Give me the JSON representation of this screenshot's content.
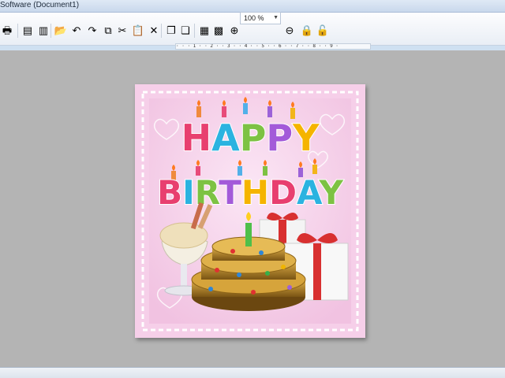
{
  "window": {
    "title": "Software  (Document1)"
  },
  "toolbar": {
    "buttons": [
      {
        "name": "print-icon",
        "glyph": "🖶"
      },
      {
        "name": "database-icon",
        "glyph": "▤"
      },
      {
        "name": "database-stack-icon",
        "glyph": "▥"
      },
      {
        "name": "open-folder-icon",
        "glyph": "📂"
      },
      {
        "name": "undo-icon",
        "glyph": "↶"
      },
      {
        "name": "redo-icon",
        "glyph": "↷"
      },
      {
        "name": "copy-icon",
        "glyph": "⧉"
      },
      {
        "name": "cut-icon",
        "glyph": "✂"
      },
      {
        "name": "paste-icon",
        "glyph": "📋"
      },
      {
        "name": "delete-icon",
        "glyph": "✕"
      },
      {
        "name": "bring-front-icon",
        "glyph": "❐"
      },
      {
        "name": "send-back-icon",
        "glyph": "❏"
      },
      {
        "name": "grid-icon",
        "glyph": "▦"
      },
      {
        "name": "grid-snap-icon",
        "glyph": "▩"
      },
      {
        "name": "zoom-in-icon",
        "glyph": "⊕"
      },
      {
        "name": "zoom-out-icon",
        "glyph": "⊖"
      },
      {
        "name": "lock-icon",
        "glyph": "🔒"
      },
      {
        "name": "unlock-icon",
        "glyph": "🔓"
      }
    ],
    "zoom_value": "100 %"
  },
  "ruler": {
    "text": "·  ·  · 1 ·  · 2 ·  · 3 ·  · 4 ·  · 5 ·  · 6 ·  · 7 ·  · 8 ·  · 9 ·"
  },
  "card": {
    "line1": "HAPPY",
    "line2": "BIRTHDAY",
    "colors": {
      "background": "#f6cfe9",
      "border": "#ffffff",
      "cake": "#b8862a",
      "gift": "#f4f4f4",
      "ribbon": "#d83030"
    },
    "letter_colors": [
      "#e83f6f",
      "#2bb3e0",
      "#7dc243",
      "#a35ad9",
      "#f5b400"
    ]
  }
}
